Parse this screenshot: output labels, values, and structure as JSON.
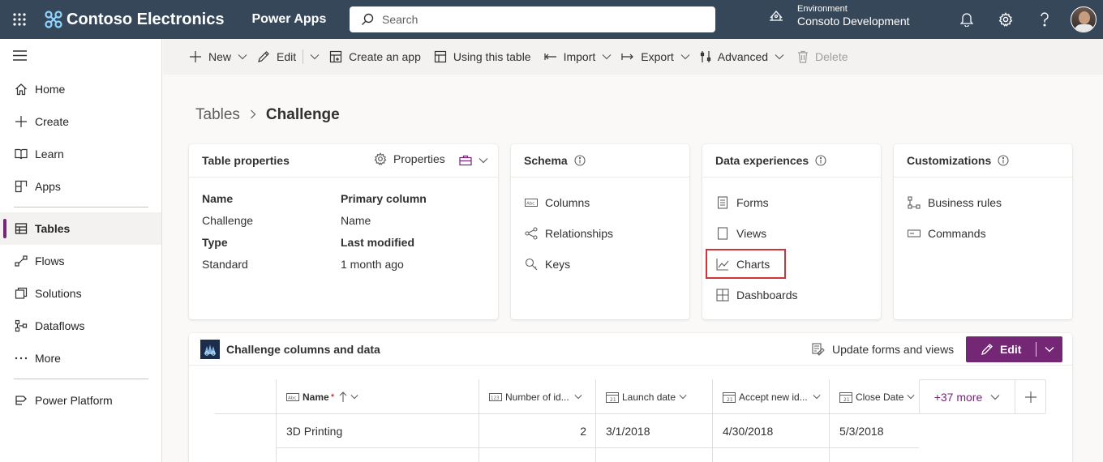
{
  "topbar": {
    "brand": "Contoso Electronics",
    "app": "Power Apps",
    "search_placeholder": "Search",
    "env_label": "Environment",
    "env_name": "Consoto Development"
  },
  "sidebar": {
    "items": [
      {
        "label": "Home",
        "icon": "home-icon"
      },
      {
        "label": "Create",
        "icon": "plus-icon"
      },
      {
        "label": "Learn",
        "icon": "book-icon"
      },
      {
        "label": "Apps",
        "icon": "apps-icon"
      },
      {
        "label": "Tables",
        "icon": "table-icon",
        "active": true
      },
      {
        "label": "Flows",
        "icon": "flow-icon"
      },
      {
        "label": "Solutions",
        "icon": "solutions-icon"
      },
      {
        "label": "Dataflows",
        "icon": "dataflow-icon"
      },
      {
        "label": "More",
        "icon": "ellipsis-icon"
      },
      {
        "label": "Power Platform",
        "icon": "power-platform-icon"
      }
    ]
  },
  "cmdbar": {
    "new": "New",
    "edit": "Edit",
    "create_app": "Create an app",
    "using_table": "Using this table",
    "import": "Import",
    "export": "Export",
    "advanced": "Advanced",
    "delete": "Delete"
  },
  "breadcrumb": {
    "parent": "Tables",
    "sep": ">",
    "current": "Challenge"
  },
  "table_properties": {
    "title": "Table properties",
    "properties_label": "Properties",
    "name_label": "Name",
    "name_value": "Challenge",
    "primary_label": "Primary column",
    "primary_value": "Name",
    "type_label": "Type",
    "type_value": "Standard",
    "modified_label": "Last modified",
    "modified_value": "1 month ago"
  },
  "schema": {
    "title": "Schema",
    "items": [
      "Columns",
      "Relationships",
      "Keys"
    ]
  },
  "data_experiences": {
    "title": "Data experiences",
    "items": [
      "Forms",
      "Views",
      "Charts",
      "Dashboards"
    ]
  },
  "customizations": {
    "title": "Customizations",
    "items": [
      "Business rules",
      "Commands"
    ]
  },
  "data_panel": {
    "title": "Challenge columns and data",
    "update": "Update forms and views",
    "edit": "Edit",
    "columns": [
      {
        "label": "Name",
        "required": "*"
      },
      {
        "label": "Number of id..."
      },
      {
        "label": "Launch date"
      },
      {
        "label": "Accept new id..."
      },
      {
        "label": "Close Date"
      }
    ],
    "more": "+37 more",
    "rows": [
      [
        "3D Printing",
        "2",
        "3/1/2018",
        "4/30/2018",
        "5/3/2018"
      ]
    ]
  }
}
